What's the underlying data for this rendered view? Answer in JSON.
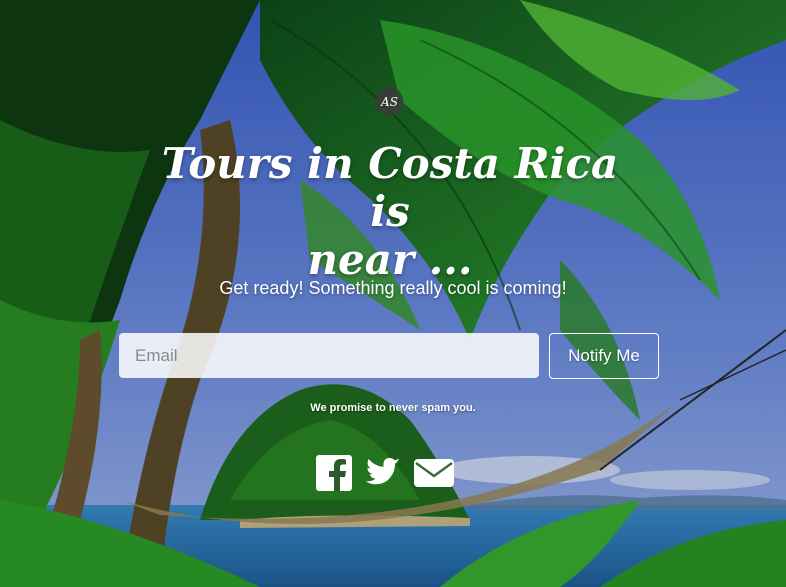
{
  "logo": {
    "text": "AS"
  },
  "hero": {
    "title_line1": "Tours in Costa Rica is",
    "title_line2": "near ...",
    "subtitle": "Get ready! Something really cool is coming!"
  },
  "form": {
    "email_placeholder": "Email",
    "notify_label": "Notify Me",
    "disclaimer": "We promise to never spam you."
  },
  "social": {
    "icons": [
      "facebook-icon",
      "twitter-icon",
      "email-icon"
    ]
  },
  "colors": {
    "text": "#ffffff",
    "sky": "#4d79d6",
    "sea": "#2f7fc0",
    "jungle": "#1f7a22"
  }
}
